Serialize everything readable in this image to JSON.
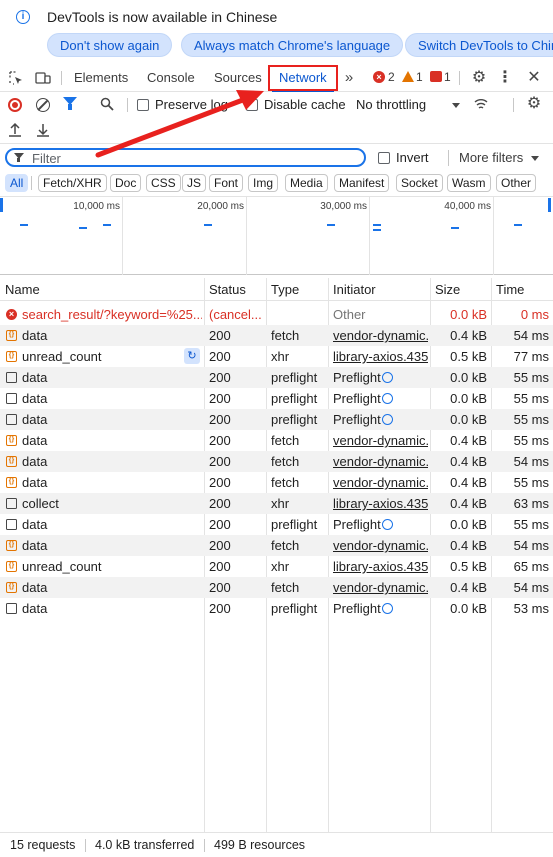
{
  "infobar": {
    "message": "DevTools is now available in Chinese",
    "buttons": [
      "Don't show again",
      "Always match Chrome's language",
      "Switch DevTools to Chinese"
    ]
  },
  "tabs": [
    "Elements",
    "Console",
    "Sources",
    "Network"
  ],
  "active_tab": "Network",
  "counters": {
    "errors": "2",
    "warnings": "1",
    "issues": "1"
  },
  "toolbar": {
    "preserve_log": "Preserve log",
    "disable_cache": "Disable cache",
    "throttling": "No throttling"
  },
  "filter": {
    "placeholder": "Filter",
    "invert": "Invert",
    "more_filters": "More filters"
  },
  "type_filters": [
    "All",
    "Fetch/XHR",
    "Doc",
    "CSS",
    "JS",
    "Font",
    "Img",
    "Media",
    "Manifest",
    "Socket",
    "Wasm",
    "Other"
  ],
  "overview_ticks": [
    "10,000 ms",
    "20,000 ms",
    "30,000 ms",
    "40,000 ms"
  ],
  "columns": [
    "Name",
    "Status",
    "Type",
    "Initiator",
    "Size",
    "Time"
  ],
  "requests": [
    {
      "name": "search_result/?keyword=%25...",
      "status": "(cancel...",
      "type": "",
      "initiator": "Other",
      "size": "0.0 kB",
      "time": "0 ms",
      "icon": "error"
    },
    {
      "name": "data",
      "status": "200",
      "type": "fetch",
      "initiator": "vendor-dynamic.",
      "size": "0.4 kB",
      "time": "54 ms",
      "icon": "fetch"
    },
    {
      "name": "unread_count",
      "status": "200",
      "type": "xhr",
      "initiator": "library-axios.435",
      "size": "0.5 kB",
      "time": "77 ms",
      "icon": "fetch"
    },
    {
      "name": "data",
      "status": "200",
      "type": "preflight",
      "initiator": "Preflight",
      "size": "0.0 kB",
      "time": "55 ms",
      "icon": "doc"
    },
    {
      "name": "data",
      "status": "200",
      "type": "preflight",
      "initiator": "Preflight",
      "size": "0.0 kB",
      "time": "55 ms",
      "icon": "doc"
    },
    {
      "name": "data",
      "status": "200",
      "type": "preflight",
      "initiator": "Preflight",
      "size": "0.0 kB",
      "time": "55 ms",
      "icon": "doc"
    },
    {
      "name": "data",
      "status": "200",
      "type": "fetch",
      "initiator": "vendor-dynamic.",
      "size": "0.4 kB",
      "time": "55 ms",
      "icon": "fetch"
    },
    {
      "name": "data",
      "status": "200",
      "type": "fetch",
      "initiator": "vendor-dynamic.",
      "size": "0.4 kB",
      "time": "54 ms",
      "icon": "fetch"
    },
    {
      "name": "data",
      "status": "200",
      "type": "fetch",
      "initiator": "vendor-dynamic.",
      "size": "0.4 kB",
      "time": "55 ms",
      "icon": "fetch"
    },
    {
      "name": "collect",
      "status": "200",
      "type": "xhr",
      "initiator": "library-axios.435",
      "size": "0.4 kB",
      "time": "63 ms",
      "icon": "doc"
    },
    {
      "name": "data",
      "status": "200",
      "type": "preflight",
      "initiator": "Preflight",
      "size": "0.0 kB",
      "time": "55 ms",
      "icon": "doc"
    },
    {
      "name": "data",
      "status": "200",
      "type": "fetch",
      "initiator": "vendor-dynamic.",
      "size": "0.4 kB",
      "time": "54 ms",
      "icon": "fetch"
    },
    {
      "name": "unread_count",
      "status": "200",
      "type": "xhr",
      "initiator": "library-axios.435",
      "size": "0.5 kB",
      "time": "65 ms",
      "icon": "fetch"
    },
    {
      "name": "data",
      "status": "200",
      "type": "fetch",
      "initiator": "vendor-dynamic.",
      "size": "0.4 kB",
      "time": "54 ms",
      "icon": "fetch"
    },
    {
      "name": "data",
      "status": "200",
      "type": "preflight",
      "initiator": "Preflight",
      "size": "0.0 kB",
      "time": "53 ms",
      "icon": "doc"
    }
  ],
  "summary": {
    "requests": "15 requests",
    "transferred": "4.0 kB transferred",
    "resources": "499 B resources"
  },
  "colors": {
    "accent": "#0b57d0",
    "error": "#d93025",
    "warning": "#e37400",
    "highlight": "#e8211e"
  }
}
